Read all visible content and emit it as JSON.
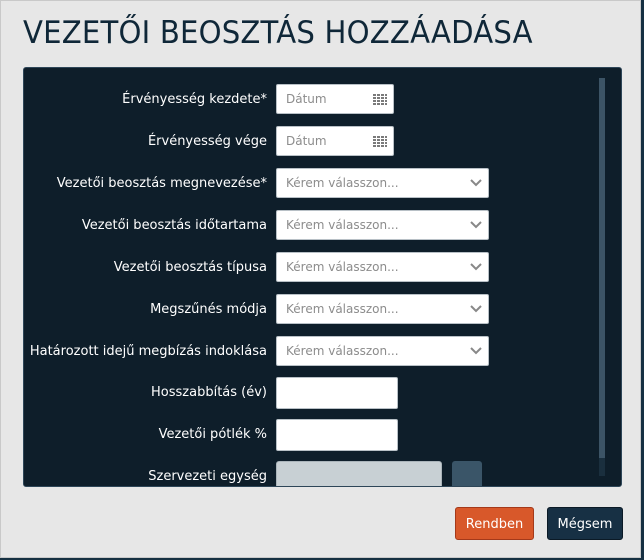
{
  "dialog": {
    "title": "VEZETŐI BEOSZTÁS HOZZÁADÁSA"
  },
  "form": {
    "start_date": {
      "label": "Érvényesség kezdete*",
      "placeholder": "Dátum"
    },
    "end_date": {
      "label": "Érvényesség vége",
      "placeholder": "Dátum"
    },
    "position_name": {
      "label": "Vezetői beosztás megnevezése*",
      "value": "Kérem válasszon..."
    },
    "position_duration": {
      "label": "Vezetői beosztás időtartama",
      "value": "Kérem válasszon..."
    },
    "position_type": {
      "label": "Vezetői beosztás típusa",
      "value": "Kérem válasszon..."
    },
    "termination_method": {
      "label": "Megszűnés módja",
      "value": "Kérem válasszon..."
    },
    "fixed_term_reason": {
      "label": "Határozott idejű megbízás indoklása",
      "value": "Kérem válasszon..."
    },
    "extension_years": {
      "label": "Hosszabbítás (év)",
      "value": ""
    },
    "allowance_percent": {
      "label": "Vezetői pótlék %",
      "value": ""
    },
    "org_unit": {
      "label": "Szervezeti egység"
    }
  },
  "buttons": {
    "ok_label": "Rendben",
    "cancel_label": "Mégsem"
  },
  "icons": {
    "calendar": "calendar-icon",
    "dropdown": "chevron-down-icon"
  },
  "colors": {
    "ok_button": "#d8582a",
    "cancel_button": "#173044",
    "panel_bg": "#0e1e2a",
    "title_text": "#0f2738"
  }
}
